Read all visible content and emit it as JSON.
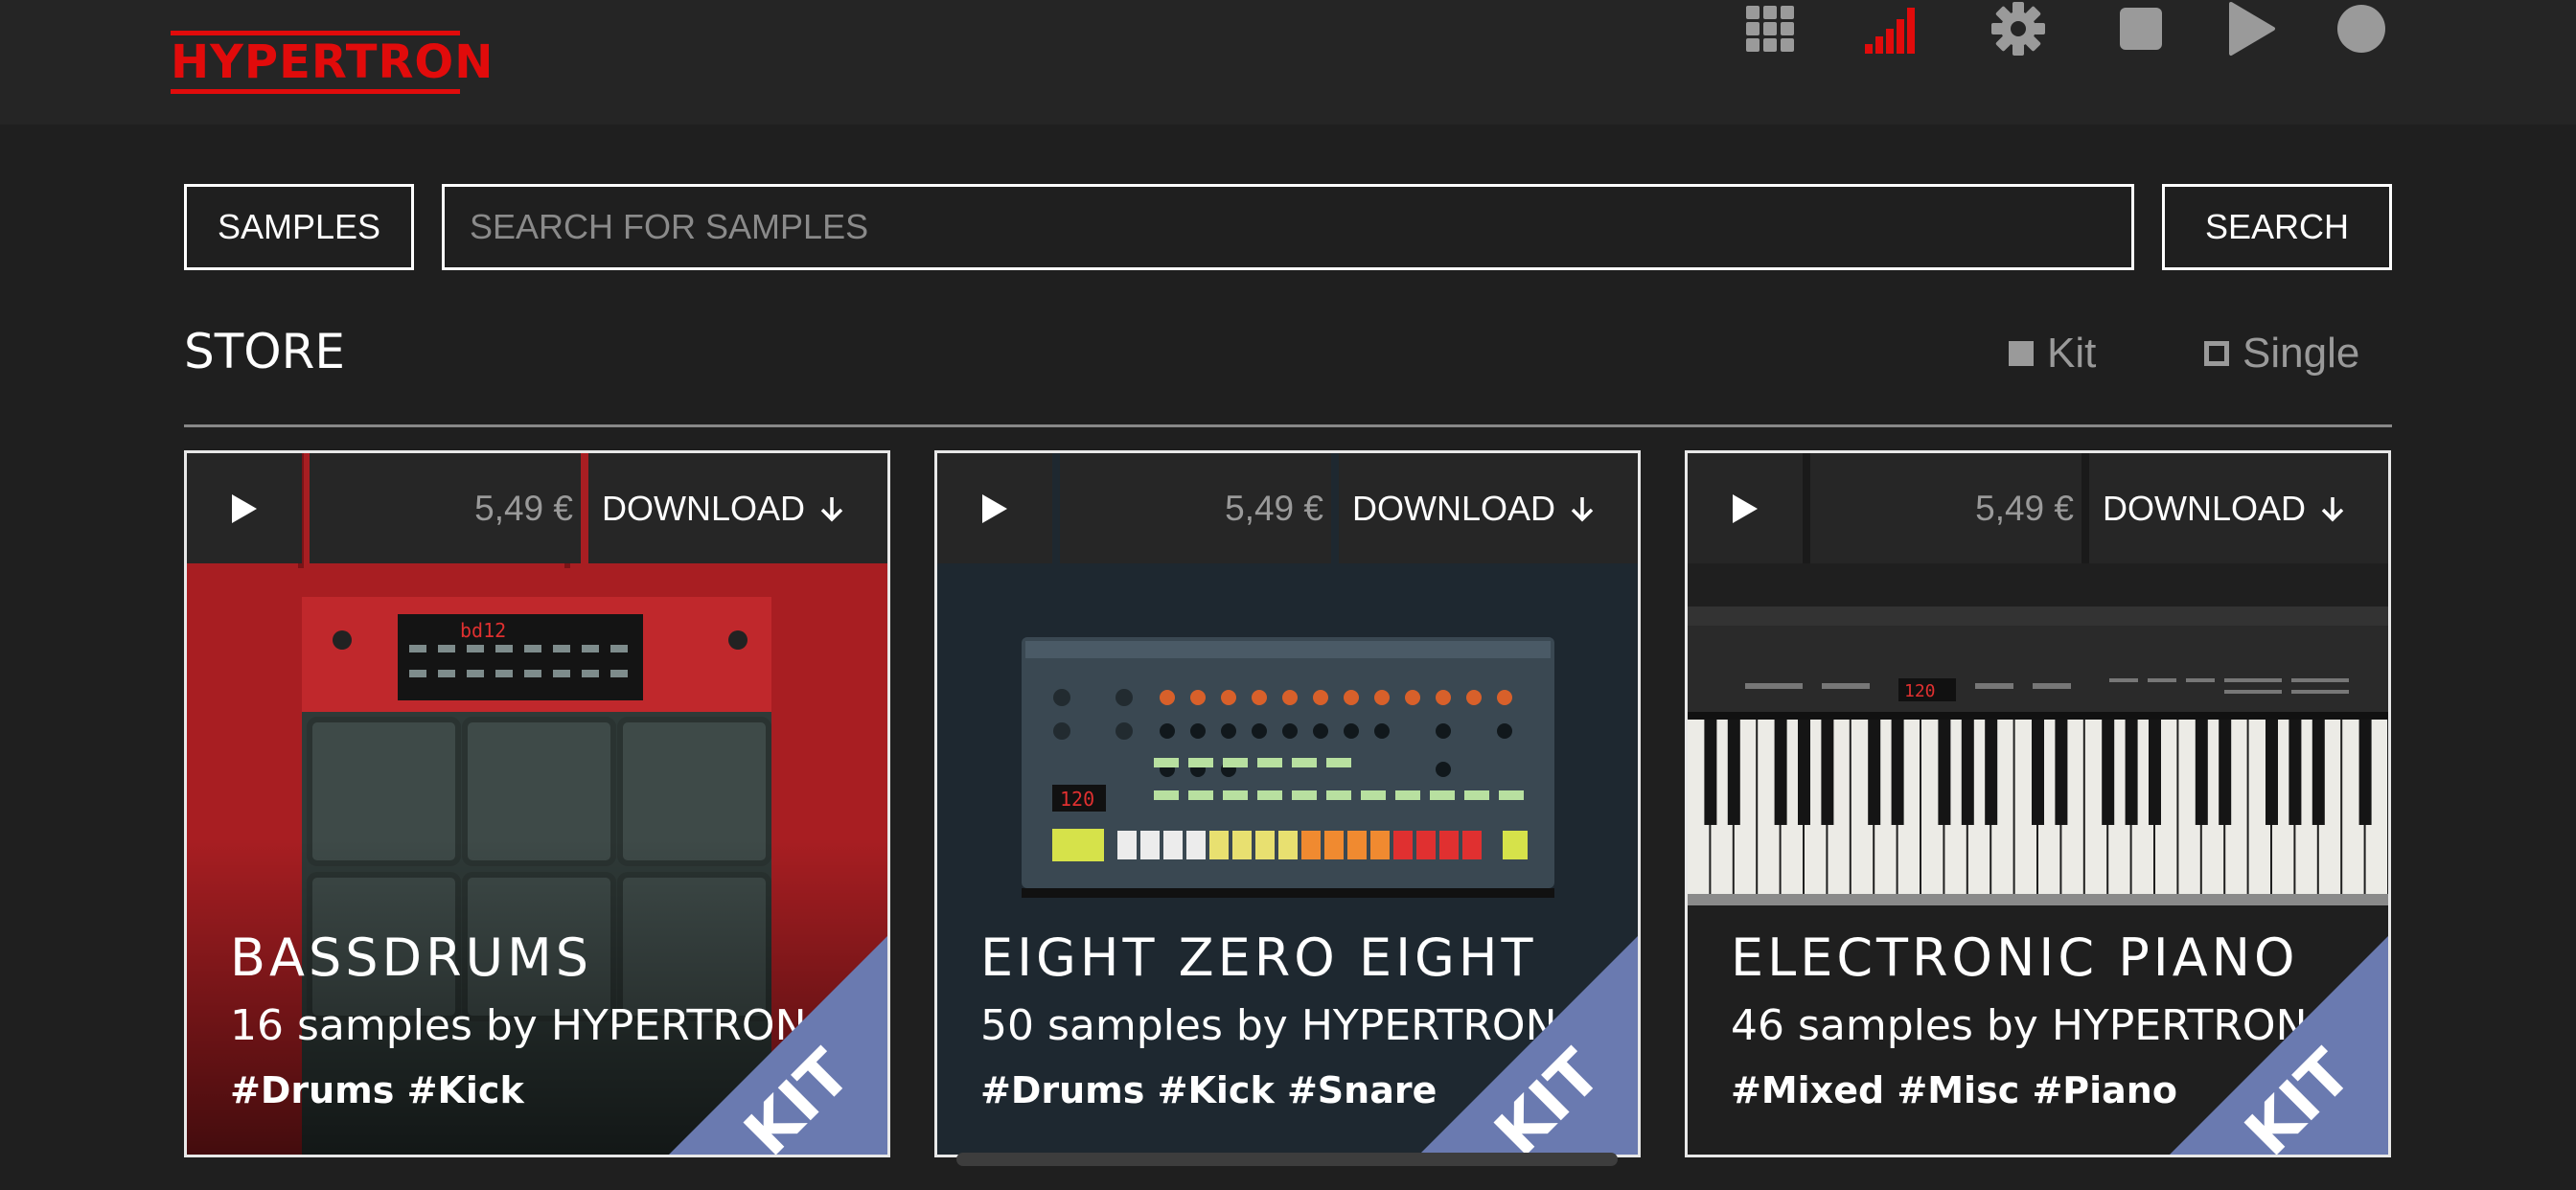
{
  "app": {
    "logo": "HYPERTRON",
    "accent_color": "#e10b0b",
    "icons": [
      "grid-icon",
      "signal-bars-icon",
      "gear-icon",
      "stop-icon",
      "play-icon",
      "record-icon"
    ]
  },
  "search": {
    "category_label": "SAMPLES",
    "placeholder": "SEARCH FOR SAMPLES",
    "value": "",
    "button_label": "SEARCH"
  },
  "store": {
    "title": "STORE",
    "filters": [
      {
        "label": "Kit",
        "selected": true
      },
      {
        "label": "Single",
        "selected": false
      }
    ]
  },
  "cards": [
    {
      "price": "5,49 €",
      "download_label": "DOWNLOAD",
      "name": "BASSDRUMS",
      "subtitle": "16 samples by HYPERTRON",
      "tags": "#Drums #Kick",
      "badge": "KIT",
      "display_text": "bd12"
    },
    {
      "price": "5,49 €",
      "download_label": "DOWNLOAD",
      "name": "EIGHT ZERO EIGHT",
      "subtitle": "50 samples by HYPERTRON",
      "tags": "#Drums #Kick #Snare",
      "badge": "KIT",
      "display_text": "120"
    },
    {
      "price": "5,49 €",
      "download_label": "DOWNLOAD",
      "name": "ELECTRONIC PIANO",
      "subtitle": "46 samples by HYPERTRON",
      "tags": "#Mixed #Misc #Piano",
      "badge": "KIT",
      "display_text": "120"
    }
  ]
}
